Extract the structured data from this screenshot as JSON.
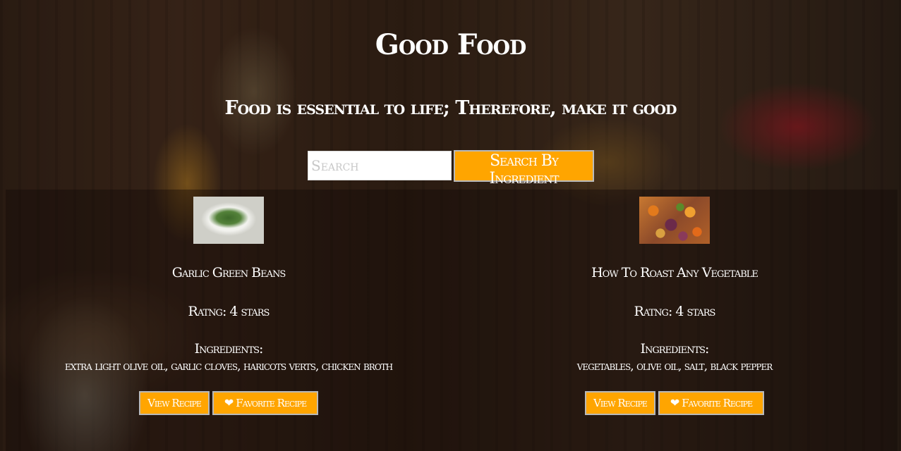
{
  "app": {
    "title": "Good Food",
    "tagline": "Food is essential to life; Therefore, make it good"
  },
  "search": {
    "placeholder": "Search",
    "value": "",
    "button_label": "Search By Ingredient"
  },
  "recipes": [
    {
      "title": "Garlic Green Beans",
      "rating": "Ratng: 4 stars",
      "ingredients_label": "Ingredients:",
      "ingredients": "extra light olive oil, garlic cloves, haricots verts, chicken broth",
      "view_label": "View Recipe",
      "favorite_label": "Favorite Recipe",
      "image_icon": "green-beans-photo"
    },
    {
      "title": "How To Roast Any Vegetable",
      "rating": "Ratng: 4 stars",
      "ingredients_label": "Ingredients:",
      "ingredients": "vegetables, olive oil, salt, black pepper",
      "view_label": "View Recipe",
      "favorite_label": "Favorite Recipe",
      "image_icon": "roasted-vegetables-photo"
    }
  ],
  "icons": {
    "heart": "❤"
  },
  "colors": {
    "accent": "#ffa500",
    "button_border": "#b9b9b9",
    "text": "#ffffff"
  }
}
